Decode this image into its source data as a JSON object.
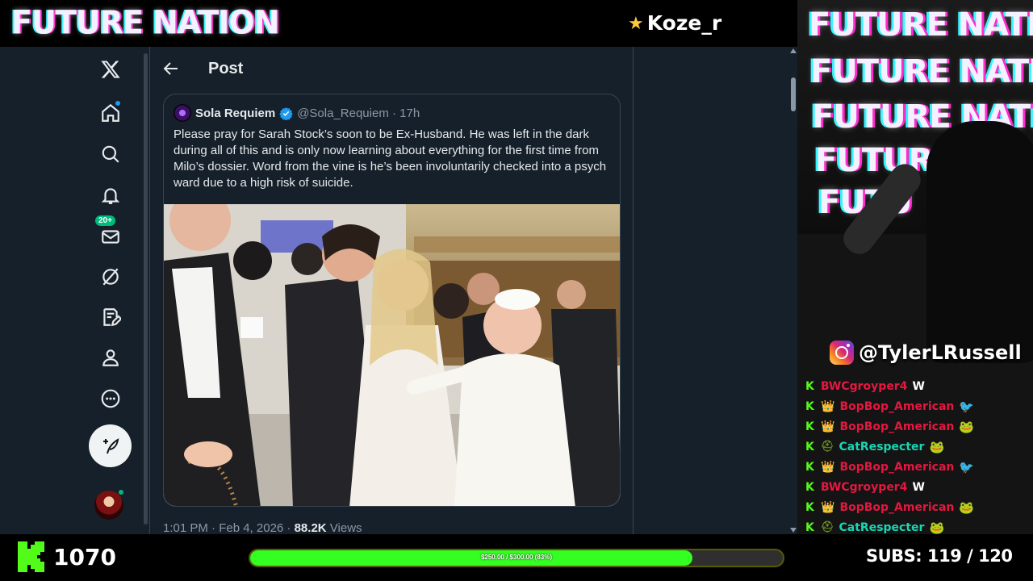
{
  "overlay": {
    "top_logo": "FUTURE NATION",
    "streamer_name": "Koze_r",
    "glitch_lines": [
      "FUTURE NATION",
      "FUTURE NATION",
      "FUTURE NATION",
      "FUTURE N",
      "FUTU"
    ],
    "instagram_handle": "@TylerLRussell",
    "follower_count": "1070",
    "goal_label": "$250.00 / $300.00 (83%)",
    "goal_progress": 0.83,
    "subs_label": "SUBS:",
    "subs_value": "119 / 120",
    "colors": {
      "kick_green": "#53fc18",
      "goal_fill": "#33ff22",
      "chat_red": "#e5173f",
      "chat_teal": "#19d6b4"
    }
  },
  "twitter": {
    "nav": [
      {
        "name": "x-logo-icon"
      },
      {
        "name": "home-icon"
      },
      {
        "name": "search-icon"
      },
      {
        "name": "notifications-icon"
      },
      {
        "name": "messages-icon",
        "badge": "20+"
      },
      {
        "name": "grok-icon"
      },
      {
        "name": "lists-icon"
      },
      {
        "name": "profile-icon"
      },
      {
        "name": "more-icon"
      }
    ],
    "page_title": "Post",
    "quote": {
      "author_name": "Sola Requiem",
      "author_meta": "@Sola_Requiem · 17h",
      "text": "Please pray for Sarah Stock’s soon to be Ex-Husband. He was left in the dark during all of this and is only now learning about everything for the first time from Milo’s dossier. Word from the vine is he’s been involuntarily checked into a psych ward due to a high risk of suicide."
    },
    "meta": {
      "time_date": "1:01 PM · Feb 4, 2026 · ",
      "views_count": "88.2K",
      "views_label": " Views"
    }
  },
  "chat": [
    {
      "user": "BWCgroyper4",
      "color": "#e5173f",
      "badge": "none",
      "msg": "W",
      "emote": ""
    },
    {
      "user": "BopBop_American",
      "color": "#e5173f",
      "badge": "crown",
      "msg": "",
      "emote": "🐦"
    },
    {
      "user": "BopBop_American",
      "color": "#e5173f",
      "badge": "crown",
      "msg": "",
      "emote": "🐸"
    },
    {
      "user": "CatRespecter",
      "color": "#19d6b4",
      "badge": "helmet",
      "msg": "",
      "emote": "🐸"
    },
    {
      "user": "BopBop_American",
      "color": "#e5173f",
      "badge": "crown",
      "msg": "",
      "emote": "🐦"
    },
    {
      "user": "BWCgroyper4",
      "color": "#e5173f",
      "badge": "none",
      "msg": "W",
      "emote": ""
    },
    {
      "user": "BopBop_American",
      "color": "#e5173f",
      "badge": "crown",
      "msg": "",
      "emote": "🐸"
    },
    {
      "user": "CatRespecter",
      "color": "#19d6b4",
      "badge": "helmet",
      "msg": "",
      "emote": "🐸"
    }
  ]
}
